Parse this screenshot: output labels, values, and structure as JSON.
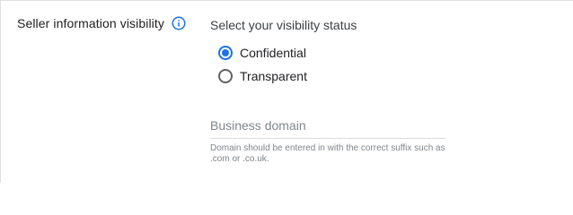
{
  "section": {
    "label": "Seller information visibility",
    "info_icon": "info-icon"
  },
  "visibility": {
    "heading": "Select your visibility status",
    "options": [
      {
        "label": "Confidential",
        "selected": true
      },
      {
        "label": "Transparent",
        "selected": false
      }
    ]
  },
  "business_domain": {
    "value": "",
    "placeholder": "Business domain",
    "hint": "Domain should be entered in with the correct suffix such as .com or .co.uk."
  },
  "colors": {
    "accent": "#1a73e8",
    "text": "#202124",
    "muted": "#80868b",
    "divider": "#e0e0e0"
  }
}
